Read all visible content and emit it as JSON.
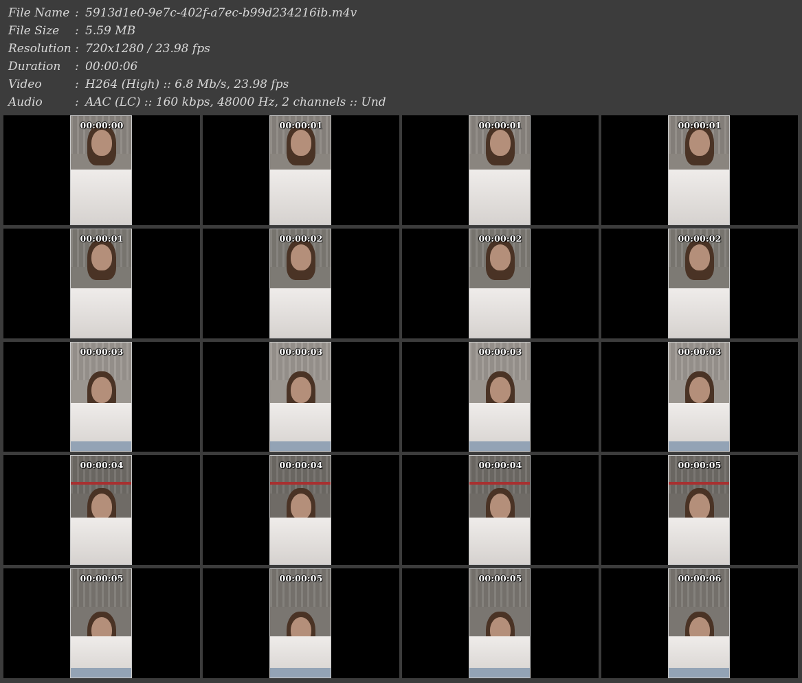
{
  "info": [
    {
      "label": "File Name",
      "sep": ":",
      "value": "5913d1e0-9e7c-402f-a7ec-b99d234216ib.m4v"
    },
    {
      "label": "File Size",
      "sep": ":",
      "value": "5.59 MB"
    },
    {
      "label": "Resolution",
      "sep": ":",
      "value": "720x1280 / 23.98 fps"
    },
    {
      "label": "Duration",
      "sep": ":",
      "value": "00:00:06"
    },
    {
      "label": "Video",
      "sep": ":",
      "value": "H264 (High) :: 6.8 Mb/s, 23.98 fps"
    },
    {
      "label": "Audio",
      "sep": ":",
      "value": "AAC (LC) :: 160 kbps, 48000 Hz, 2 channels :: Und"
    }
  ],
  "thumbnails": [
    "00:00:00",
    "00:00:01",
    "00:00:01",
    "00:00:01",
    "00:00:01",
    "00:00:02",
    "00:00:02",
    "00:00:02",
    "00:00:03",
    "00:00:03",
    "00:00:03",
    "00:00:03",
    "00:00:04",
    "00:00:04",
    "00:00:04",
    "00:00:05",
    "00:00:05",
    "00:00:05",
    "00:00:05",
    "00:00:06"
  ],
  "colors": {
    "header_bg": "#3c3c3c",
    "header_text": "#d8d8d8",
    "cell_bg": "#000000",
    "thumb_border": "#c8c8c8"
  }
}
